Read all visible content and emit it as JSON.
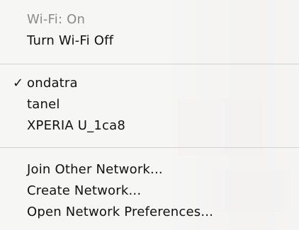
{
  "wifi_menu": {
    "status_label": "Wi-Fi: On",
    "toggle_label": "Turn Wi-Fi Off",
    "checkmark": "✓",
    "networks": [
      {
        "name": "ondatra",
        "selected": true
      },
      {
        "name": "tanel",
        "selected": false
      },
      {
        "name": "XPERIA U_1ca8",
        "selected": false
      }
    ],
    "actions": [
      "Join Other Network...",
      "Create Network...",
      "Open Network Preferences..."
    ]
  },
  "colors": {
    "menu_background": "#f6f6f6",
    "text": "#111111",
    "disabled_text": "#8a8a8a",
    "separator": "#d2d2d2"
  }
}
